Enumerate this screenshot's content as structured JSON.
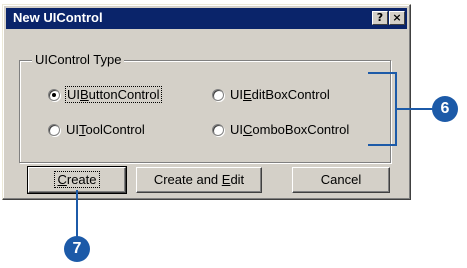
{
  "dialog": {
    "title": "New UIControl",
    "help_label": "?",
    "close_label": "×"
  },
  "group": {
    "label": "UIControl Type",
    "options": [
      {
        "pre": "UI",
        "accel": "B",
        "post": "uttonControl",
        "checked": true
      },
      {
        "pre": "UI",
        "accel": "E",
        "post": "ditBoxControl",
        "checked": false
      },
      {
        "pre": "UI",
        "accel": "T",
        "post": "oolControl",
        "checked": false
      },
      {
        "pre": "UI",
        "accel": "C",
        "post": "omboBoxControl",
        "checked": false
      }
    ]
  },
  "buttons": {
    "create": {
      "accel": "C",
      "post": "reate"
    },
    "create_edit": {
      "pre": "Create and ",
      "accel": "E",
      "post": "dit"
    },
    "cancel": "Cancel"
  },
  "callouts": {
    "step_6": "6",
    "step_7": "7",
    "color": "#1c5aa8"
  }
}
